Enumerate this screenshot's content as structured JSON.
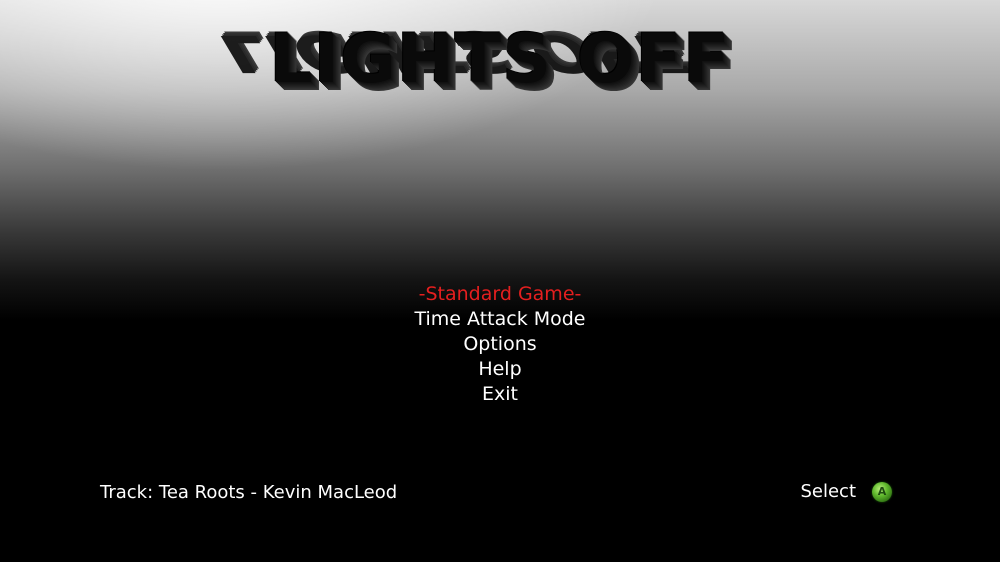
{
  "title": "LIGHTS OFF",
  "menu": {
    "items": [
      {
        "label": "-Standard Game-",
        "selected": true
      },
      {
        "label": "Time Attack Mode",
        "selected": false
      },
      {
        "label": "Options",
        "selected": false
      },
      {
        "label": "Help",
        "selected": false
      },
      {
        "label": "Exit",
        "selected": false
      }
    ],
    "selected_color": "#e51f1f",
    "default_color": "#ffffff"
  },
  "footer": {
    "track": "Track: Tea Roots - Kevin MacLeod",
    "select_label": "Select",
    "select_icon": "a-button-icon"
  }
}
